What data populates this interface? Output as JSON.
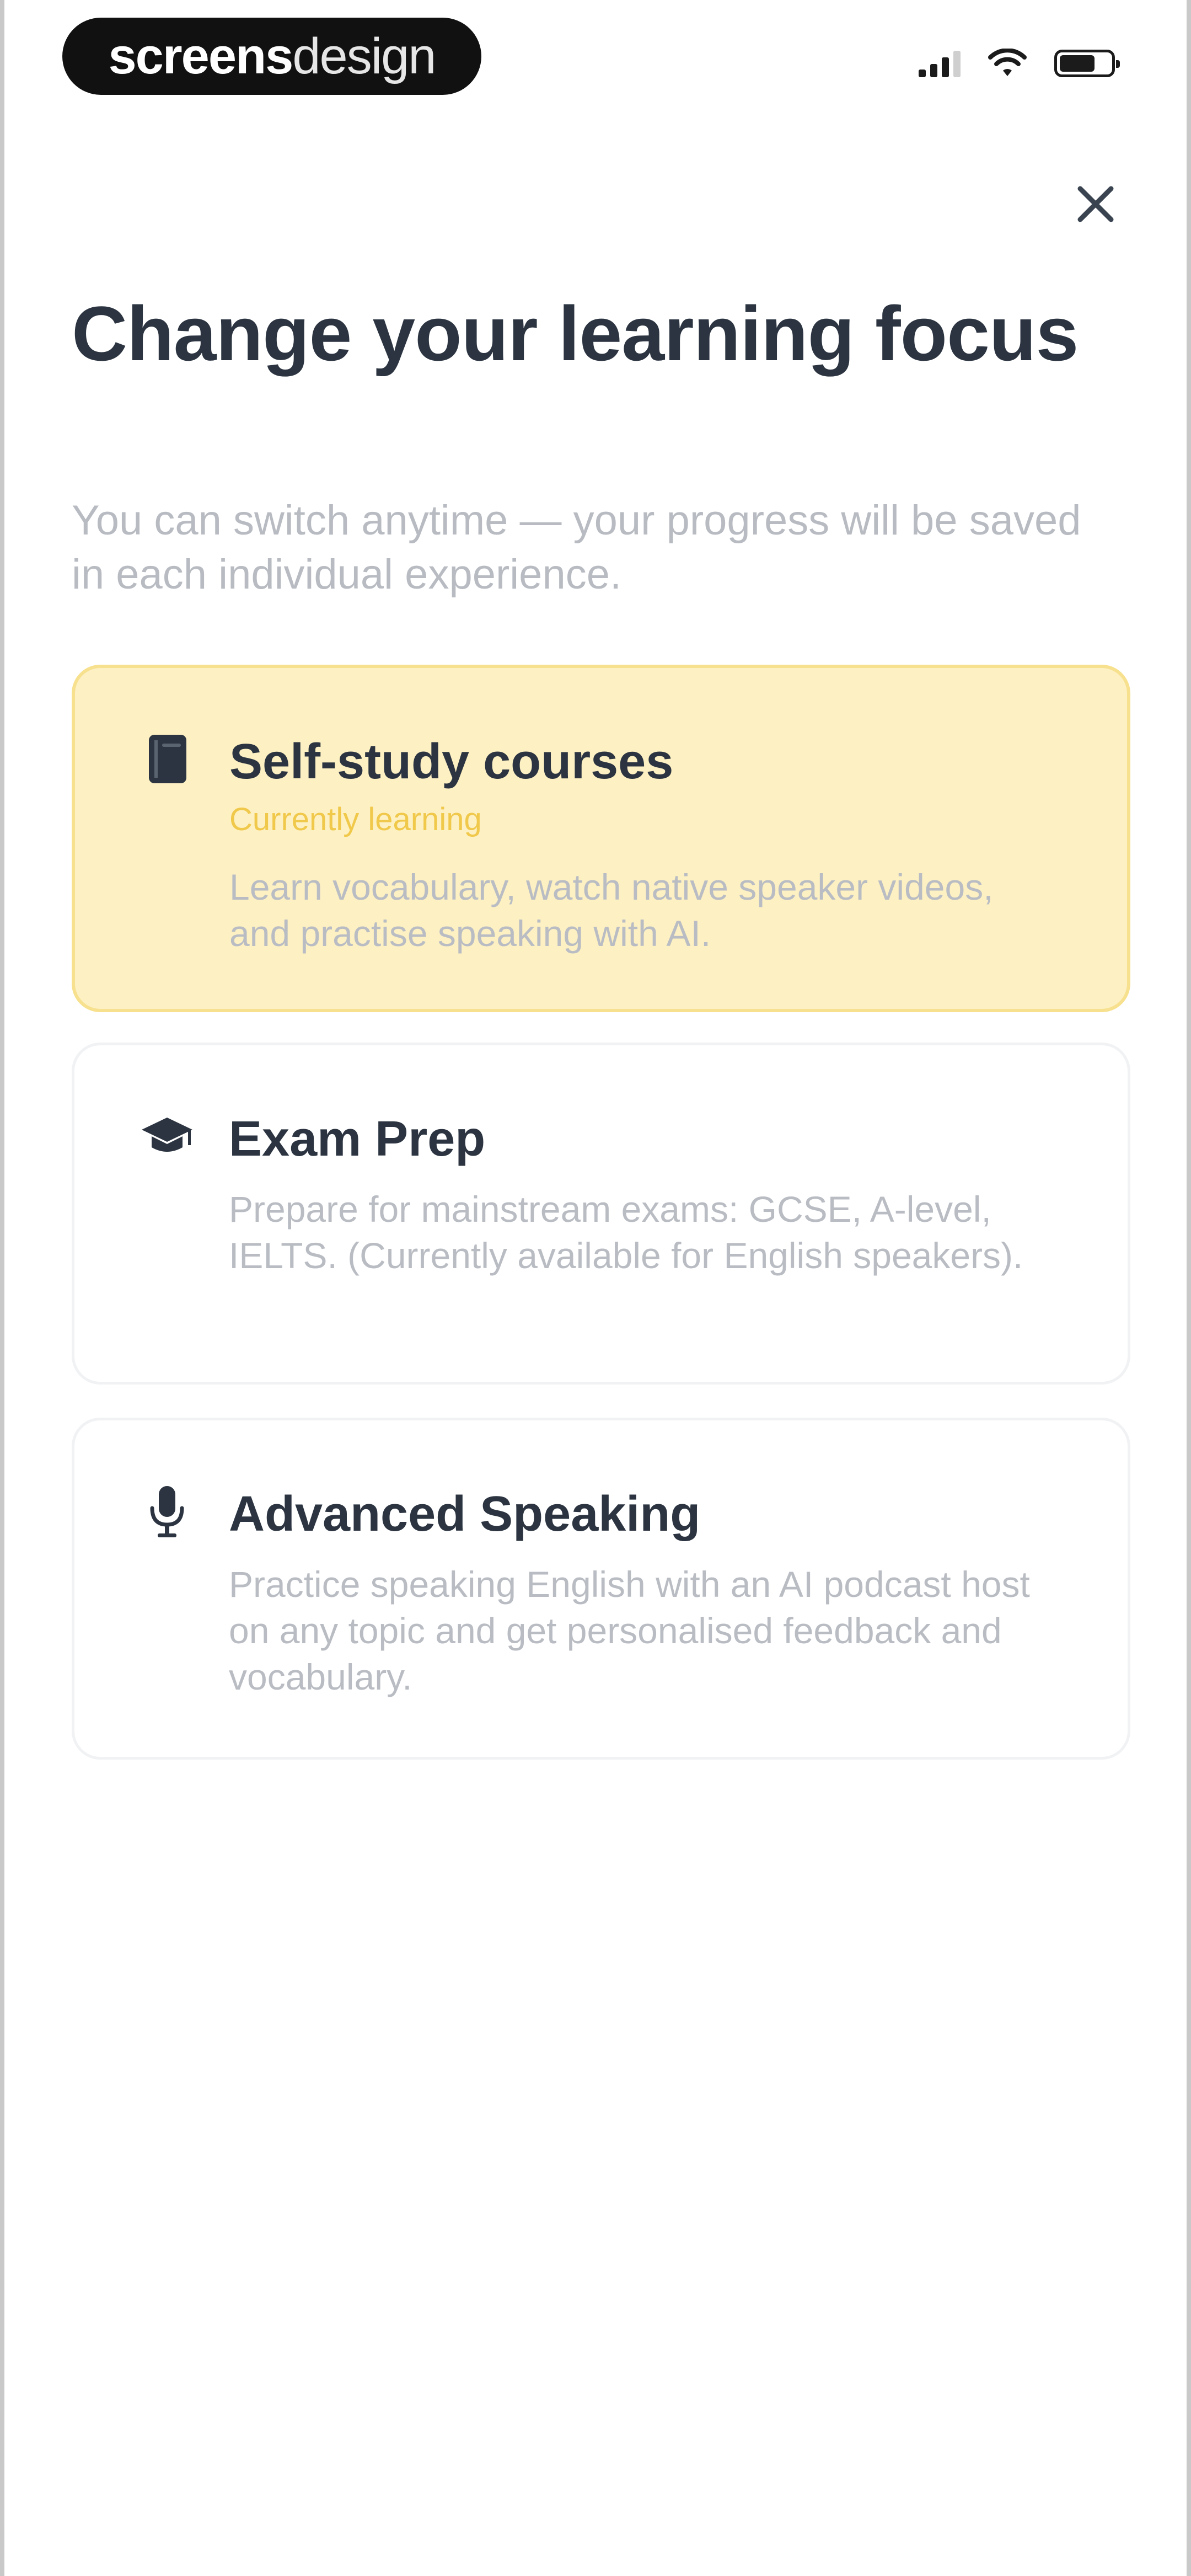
{
  "status_bar": {
    "brand_bold": "screens",
    "brand_thin": "design",
    "battery_level": 0.7
  },
  "close_icon": "close-icon",
  "header": {
    "title": "Change your learning focus",
    "subtitle": "You can switch anytime — your progress will be saved in each individual experience."
  },
  "options": [
    {
      "icon": "book-icon",
      "title": "Self-study courses",
      "badge": "Currently learning",
      "description": "Learn vocabulary, watch native speaker videos, and practise speaking with AI.",
      "selected": true
    },
    {
      "icon": "graduation-cap-icon",
      "title": "Exam Prep",
      "description": "Prepare for mainstream exams: GCSE, A-level, IELTS. (Currently available for English speakers).",
      "selected": false
    },
    {
      "icon": "microphone-icon",
      "title": "Advanced Speaking",
      "description": "Practice speaking English with an AI podcast host on any topic and get personalised feedback and vocabulary.",
      "selected": false
    }
  ],
  "colors": {
    "selected_bg": "#fdf0c3",
    "selected_border": "#f7e18e",
    "badge": "#f0c84a",
    "title": "#2b3440",
    "muted": "#b8bcc2"
  }
}
